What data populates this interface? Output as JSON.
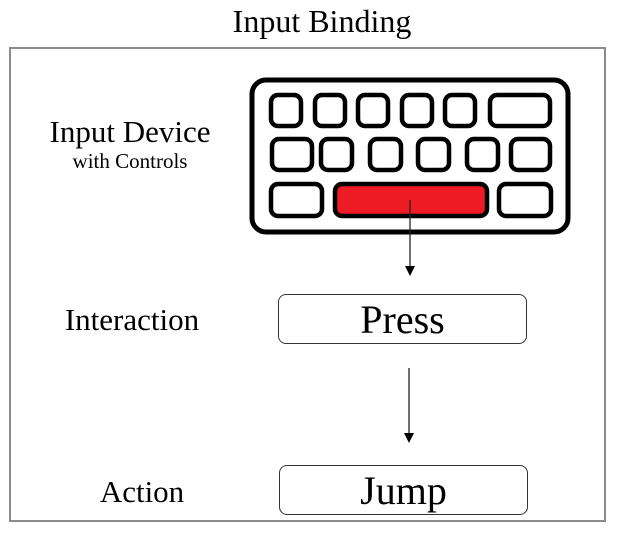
{
  "title": "Input Binding",
  "rows": {
    "device": {
      "label": "Input Device",
      "sublabel": "with Controls"
    },
    "interaction": {
      "label": "Interaction",
      "value": "Press"
    },
    "action": {
      "label": "Action",
      "value": "Jump"
    }
  },
  "keyboard": {
    "rows": [
      [
        "key",
        "key",
        "key",
        "key",
        "key",
        "wide-key"
      ],
      [
        "key",
        "key",
        "key",
        "key",
        "key",
        "key"
      ],
      [
        "key",
        "space-key",
        "key"
      ]
    ],
    "highlighted_key": "space-key",
    "highlight_color": "#ed1c24"
  }
}
